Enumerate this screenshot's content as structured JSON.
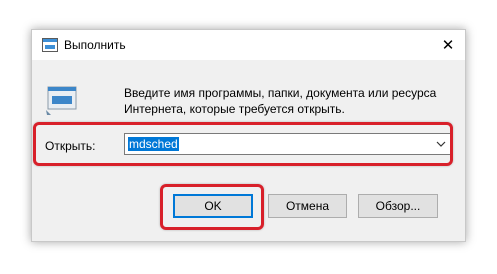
{
  "window": {
    "title": "Выполнить",
    "close_glyph": "✕"
  },
  "dialog": {
    "description": "Введите имя программы, папки, документа или ресурса Интернета, которые требуется открыть.",
    "open_label": "Открыть:",
    "open_value": "mdsched"
  },
  "buttons": {
    "ok": "OK",
    "cancel": "Отмена",
    "browse": "Обзор..."
  },
  "colors": {
    "highlight": "#d8202a",
    "selection": "#0078d7"
  }
}
